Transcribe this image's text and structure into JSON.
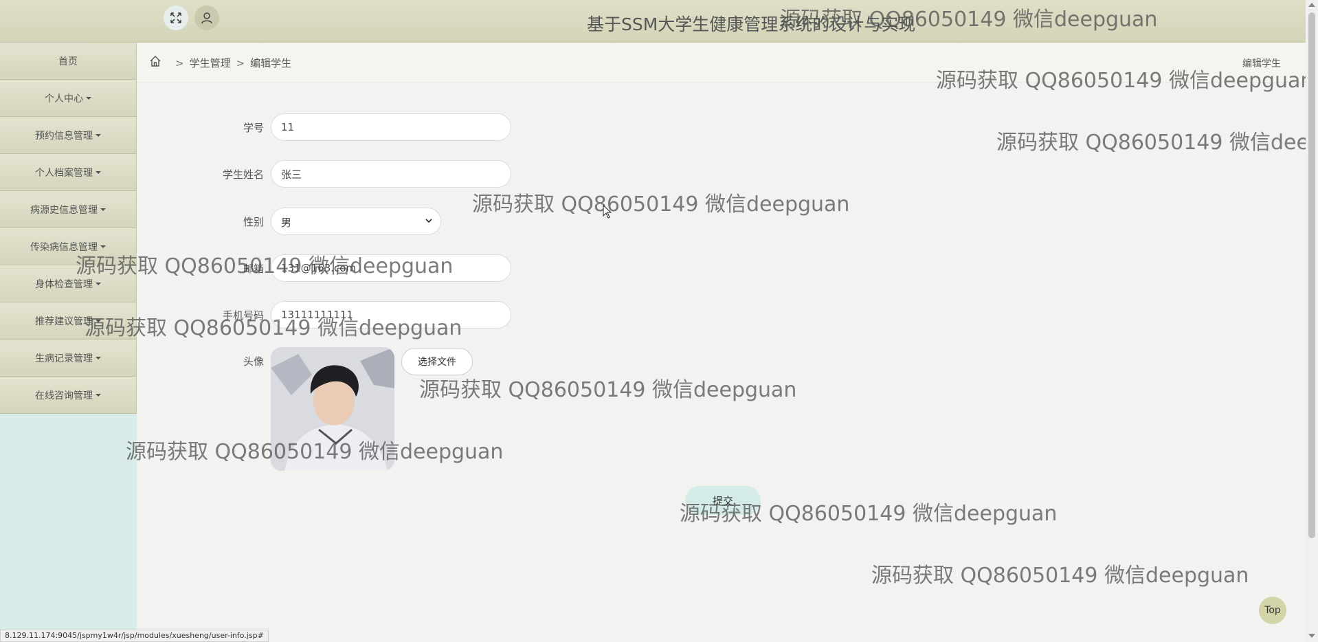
{
  "header": {
    "title": "基于SSM大学生健康管理系统的设计与实现",
    "expand_icon": "expand-icon",
    "user_icon": "user-icon"
  },
  "sidebar": {
    "items": [
      {
        "label": "首页",
        "dropdown": false
      },
      {
        "label": "个人中心",
        "dropdown": true
      },
      {
        "label": "预约信息管理",
        "dropdown": true
      },
      {
        "label": "个人档案管理",
        "dropdown": true
      },
      {
        "label": "病源史信息管理",
        "dropdown": true
      },
      {
        "label": "传染病信息管理",
        "dropdown": true
      },
      {
        "label": "身体检查管理",
        "dropdown": true
      },
      {
        "label": "推荐建议管理",
        "dropdown": true
      },
      {
        "label": "生病记录管理",
        "dropdown": true
      },
      {
        "label": "在线咨询管理",
        "dropdown": true
      }
    ]
  },
  "breadcrumb": {
    "sep": ">",
    "items": [
      "学生管理",
      "编辑学生"
    ],
    "right_title": "编辑学生"
  },
  "form": {
    "student_id": {
      "label": "学号",
      "value": "11"
    },
    "name": {
      "label": "学生姓名",
      "value": "张三"
    },
    "gender": {
      "label": "性别",
      "value": "男"
    },
    "email": {
      "label": "邮箱",
      "value": "131@163.com"
    },
    "phone": {
      "label": "手机号码",
      "value": "13111111111"
    },
    "avatar": {
      "label": "头像",
      "file_button": "选择文件"
    },
    "submit": "提交"
  },
  "watermark": "源码获取 QQ86050149 微信deepguan",
  "top_button": "Top",
  "status_url": "8.129.11.174:9045/jspmy1w4r/jsp/modules/xuesheng/user-info.jsp#",
  "colors": {
    "topbar": "#d8d8bf",
    "sidebar_bg": "#d9ecea",
    "submit_bg": "#d4ebe7",
    "top_fab": "#d4d4a9"
  }
}
